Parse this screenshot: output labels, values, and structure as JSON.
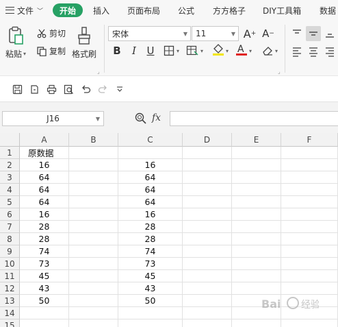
{
  "menu": {
    "file": "文件",
    "tabs": [
      "开始",
      "插入",
      "页面布局",
      "公式",
      "方方格子",
      "DIY工具箱",
      "数据"
    ]
  },
  "ribbon": {
    "paste": "粘贴",
    "cut": "剪切",
    "copy": "复制",
    "format_painter": "格式刷",
    "font_name": "宋体",
    "font_size": "11"
  },
  "formula_bar": {
    "name_box": "J16",
    "fx": "fx",
    "formula": ""
  },
  "sheet": {
    "columns": [
      "A",
      "B",
      "C",
      "D",
      "E",
      "F"
    ],
    "rows": [
      "1",
      "2",
      "3",
      "4",
      "5",
      "6",
      "7",
      "8",
      "9",
      "10",
      "11",
      "12",
      "13",
      "14",
      "15"
    ],
    "cells": [
      [
        "原数据",
        "",
        "",
        "",
        "",
        ""
      ],
      [
        "16",
        "",
        "16",
        "",
        "",
        ""
      ],
      [
        "64",
        "",
        "64",
        "",
        "",
        ""
      ],
      [
        "64",
        "",
        "64",
        "",
        "",
        ""
      ],
      [
        "64",
        "",
        "64",
        "",
        "",
        ""
      ],
      [
        "16",
        "",
        "16",
        "",
        "",
        ""
      ],
      [
        "28",
        "",
        "28",
        "",
        "",
        ""
      ],
      [
        "28",
        "",
        "28",
        "",
        "",
        ""
      ],
      [
        "74",
        "",
        "74",
        "",
        "",
        ""
      ],
      [
        "73",
        "",
        "73",
        "",
        "",
        ""
      ],
      [
        "45",
        "",
        "45",
        "",
        "",
        ""
      ],
      [
        "43",
        "",
        "43",
        "",
        "",
        ""
      ],
      [
        "50",
        "",
        "50",
        "",
        "",
        ""
      ],
      [
        "",
        "",
        "",
        "",
        "",
        ""
      ],
      [
        "",
        "",
        "",
        "",
        "",
        ""
      ]
    ]
  },
  "colors": {
    "accent": "#27a164",
    "font_color_bar": "#e02020",
    "highlight_bar": "#f2e600"
  }
}
